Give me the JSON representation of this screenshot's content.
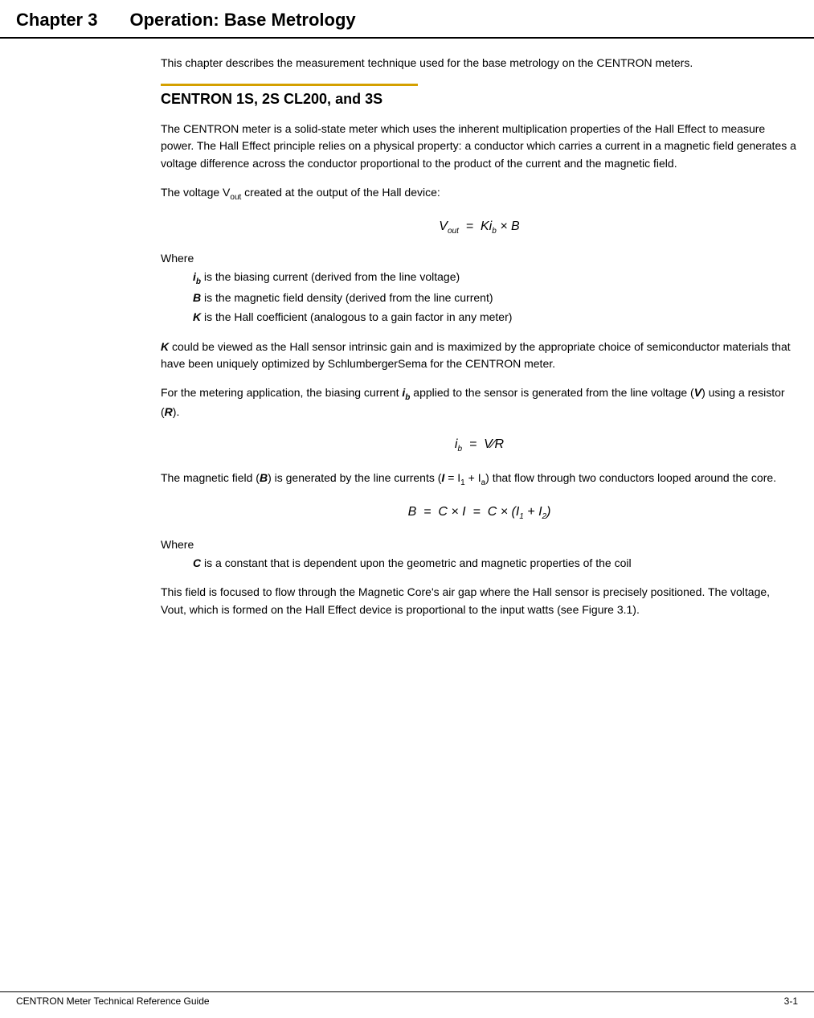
{
  "header": {
    "chapter_label": "Chapter 3",
    "chapter_title": "Operation: Base Metrology"
  },
  "intro": {
    "text": "This chapter describes the measurement technique used for the base metrology on the CENTRON meters."
  },
  "section1": {
    "heading": "CENTRON 1S, 2S CL200, and 3S",
    "paragraph1": "The CENTRON meter is a solid-state meter which uses the inherent multiplication properties of the Hall Effect to measure power. The Hall Effect principle relies on a physical property: a conductor which carries a current in a magnetic field generates a voltage difference across the conductor proportional to the product of the current and the magnetic field.",
    "paragraph2_prefix": "The voltage V",
    "paragraph2_suffix": " created at the output of the Hall device:",
    "formula1_label": "V",
    "formula1_sub": "out",
    "formula1_eq": " = Ki",
    "formula1_b_sub": "b",
    "formula1_end": " × B",
    "where_label": "Where",
    "where_item1_prefix": "i",
    "where_item1_sub": "b",
    "where_item1_text": " is the biasing current (derived from the line voltage)",
    "where_item2_prefix": "B",
    "where_item2_text": " is the magnetic field density (derived from the line current)",
    "where_item3_prefix": "K",
    "where_item3_text": " is the Hall coefficient (analogous to a gain factor in any meter)",
    "paragraph3_prefix": "K",
    "paragraph3_text": " could be viewed as the Hall sensor intrinsic gain and is maximized by the appropriate choice of semiconductor materials that have been uniquely optimized by SchlumbergerSema for the CENTRON meter.",
    "paragraph4_prefix": "For the metering application, the biasing current ",
    "paragraph4_ib": "i",
    "paragraph4_ib_sub": "b",
    "paragraph4_suffix": " applied to the sensor is generated from the line voltage (",
    "paragraph4_V": "V",
    "paragraph4_suffix2": ") using a resistor (",
    "paragraph4_R": "R",
    "paragraph4_suffix3": ").",
    "formula2_ib": "i",
    "formula2_ib_sub": "b",
    "formula2_eq": "  =  V",
    "formula2_slash": "∕",
    "formula2_R": "R",
    "paragraph5_prefix": "The magnetic field (",
    "paragraph5_B": "B",
    "paragraph5_suffix": ") is generated by the line currents (",
    "paragraph5_I": "I",
    "paragraph5_eq": " = I",
    "paragraph5_sub1": "1",
    "paragraph5_plus": " + I",
    "paragraph5_sub2": "a",
    "paragraph5_suffix2": ") that flow through two conductors looped around the core.",
    "formula3": "B  = C × I  =  C × (I",
    "formula3_sub1": "1",
    "formula3_plus": " + I",
    "formula3_sub2": "2",
    "formula3_end": ")",
    "where2_label": "Where",
    "where2_item1_prefix": "C",
    "where2_item1_text": " is a constant that is dependent upon the geometric and magnetic properties of the coil",
    "paragraph6": "This field is focused to flow through the Magnetic Core's air gap where the Hall sensor is precisely positioned. The voltage, Vout, which is formed on the Hall Effect device is proportional to the input watts (see Figure 3.1)."
  },
  "footer": {
    "left": "CENTRON Meter Technical Reference Guide",
    "right": "3-1"
  }
}
